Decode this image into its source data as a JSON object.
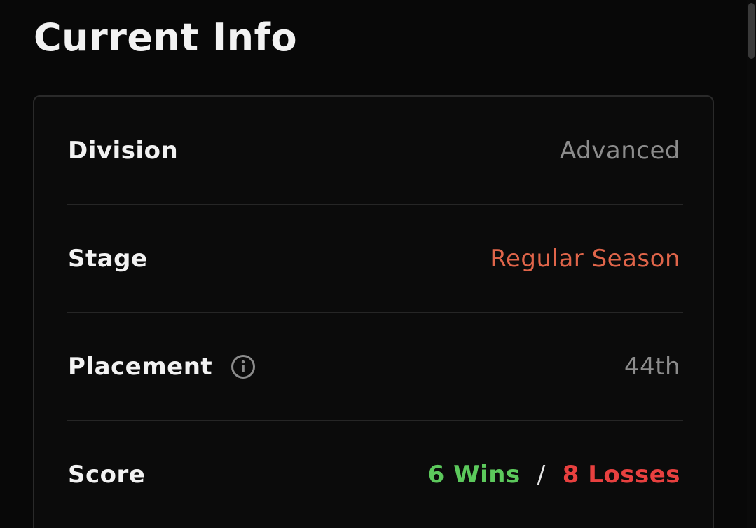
{
  "header": {
    "title": "Current Info"
  },
  "info": {
    "rows": [
      {
        "label": "Division",
        "value": "Advanced",
        "value_color": "#8c8c8c"
      },
      {
        "label": "Stage",
        "value": "Regular Season",
        "value_color": "#e0654a"
      },
      {
        "label": "Placement",
        "value": "44th",
        "value_color": "#8c8c8c",
        "icon": "info-icon"
      },
      {
        "label": "Score"
      }
    ],
    "score": {
      "wins": "6 Wins",
      "separator": "/",
      "losses": "8 Losses",
      "wins_color": "#5cc95c",
      "losses_color": "#e8403f"
    }
  },
  "colors": {
    "background": "#080808",
    "card_border": "#2a2a2a",
    "label_text": "#f2f2f2"
  }
}
